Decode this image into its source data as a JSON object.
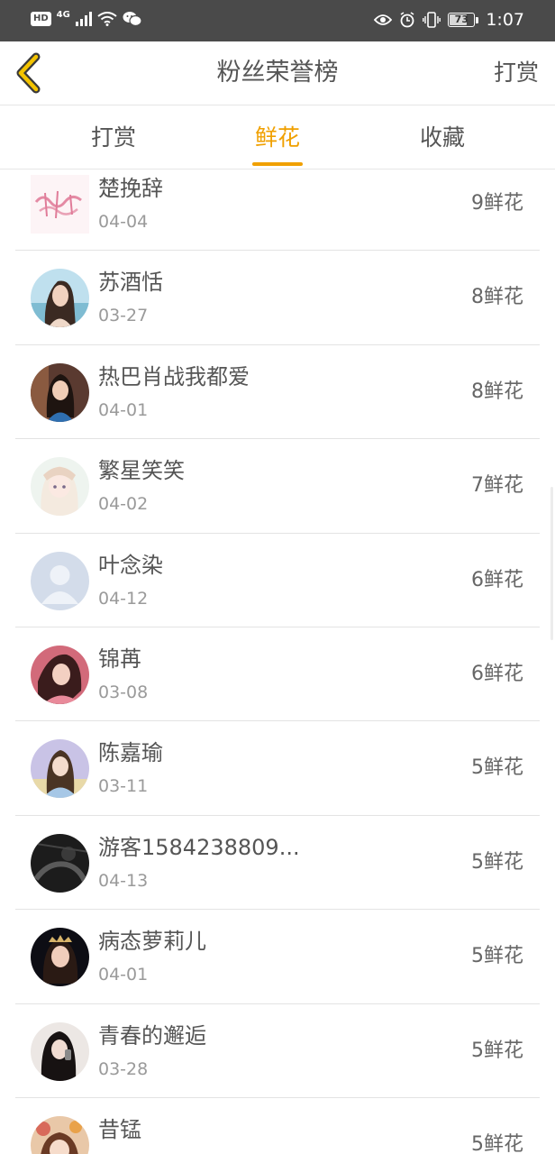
{
  "status_bar": {
    "hd": "HD",
    "network": "4G",
    "battery": "73",
    "battery_level": 0.73,
    "time": "1:07"
  },
  "header": {
    "title": "粉丝荣誉榜",
    "action": "打赏",
    "accent_color": "#f0a000"
  },
  "tabs": [
    {
      "label": "打赏",
      "active": false
    },
    {
      "label": "鲜花",
      "active": true
    },
    {
      "label": "收藏",
      "active": false
    }
  ],
  "fans": [
    {
      "name": "楚挽辞",
      "date": "04-04",
      "count": "9鲜花",
      "avatar": "logo-text-avatar"
    },
    {
      "name": "苏酒恬",
      "date": "03-27",
      "count": "8鲜花",
      "avatar": "photo-avatar"
    },
    {
      "name": "热巴肖战我都爱",
      "date": "04-01",
      "count": "8鲜花",
      "avatar": "photo-avatar"
    },
    {
      "name": "繁星笑笑",
      "date": "04-02",
      "count": "7鲜花",
      "avatar": "illustration-avatar"
    },
    {
      "name": "叶念染",
      "date": "04-12",
      "count": "6鲜花",
      "avatar": "default-avatar"
    },
    {
      "name": "锦苒",
      "date": "03-08",
      "count": "6鲜花",
      "avatar": "photo-avatar"
    },
    {
      "name": "陈嘉瑜",
      "date": "03-11",
      "count": "5鲜花",
      "avatar": "photo-avatar"
    },
    {
      "name": "游客1584238809...",
      "date": "04-13",
      "count": "5鲜花",
      "avatar": "dark-photo-avatar"
    },
    {
      "name": "病态萝莉儿",
      "date": "04-01",
      "count": "5鲜花",
      "avatar": "photo-avatar"
    },
    {
      "name": "青春的邂逅",
      "date": "03-28",
      "count": "5鲜花",
      "avatar": "photo-avatar"
    },
    {
      "name": "昔锰",
      "date": "",
      "count": "5鲜花",
      "avatar": "illustration-avatar"
    }
  ]
}
